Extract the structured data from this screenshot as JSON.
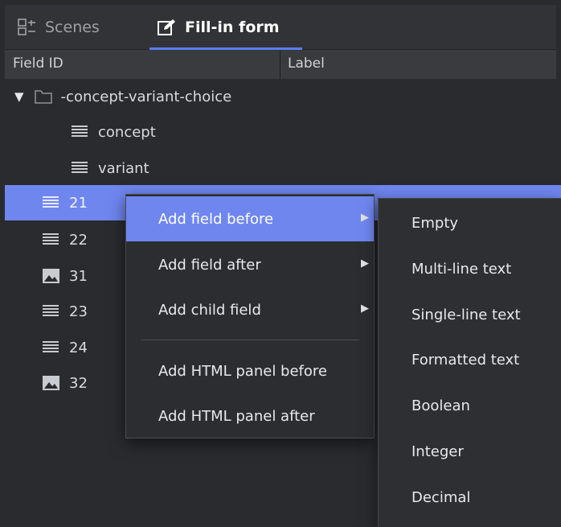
{
  "tabs": [
    {
      "label": "Scenes",
      "icon": "scenes-icon",
      "active": false
    },
    {
      "label": "Fill-in form",
      "icon": "edit-form-icon",
      "active": true
    }
  ],
  "columns": {
    "field_id": "Field ID",
    "label": "Label"
  },
  "tree": {
    "rows": [
      {
        "text": "-concept-variant-choice",
        "icon": "folder-icon",
        "expanded": true
      },
      {
        "text": "concept",
        "icon": "text-lines-icon"
      },
      {
        "text": "variant",
        "icon": "text-lines-icon"
      },
      {
        "text": "21",
        "icon": "text-lines-icon",
        "selected": true
      },
      {
        "text": "22",
        "icon": "text-lines-icon"
      },
      {
        "text": "31",
        "icon": "image-icon"
      },
      {
        "text": "23",
        "icon": "text-lines-icon"
      },
      {
        "text": "24",
        "icon": "text-lines-icon"
      },
      {
        "text": "32",
        "icon": "image-icon"
      }
    ]
  },
  "context_menu": {
    "items": [
      {
        "label": "Add field before",
        "has_submenu": true,
        "active": true
      },
      {
        "label": "Add field after",
        "has_submenu": true
      },
      {
        "label": "Add child field",
        "has_submenu": true
      },
      {
        "label": "Add HTML panel before",
        "has_submenu": false
      },
      {
        "label": "Add HTML panel after",
        "has_submenu": false
      }
    ]
  },
  "submenu": {
    "items": [
      {
        "label": "Empty"
      },
      {
        "label": "Multi-line text"
      },
      {
        "label": "Single-line text"
      },
      {
        "label": "Formatted text"
      },
      {
        "label": "Boolean"
      },
      {
        "label": "Integer"
      },
      {
        "label": "Decimal"
      }
    ]
  },
  "colors": {
    "accent": "#5b7cf2",
    "selection": "#6f86ef",
    "background": "#2a2b2d",
    "menu_background": "#2c2d30"
  }
}
